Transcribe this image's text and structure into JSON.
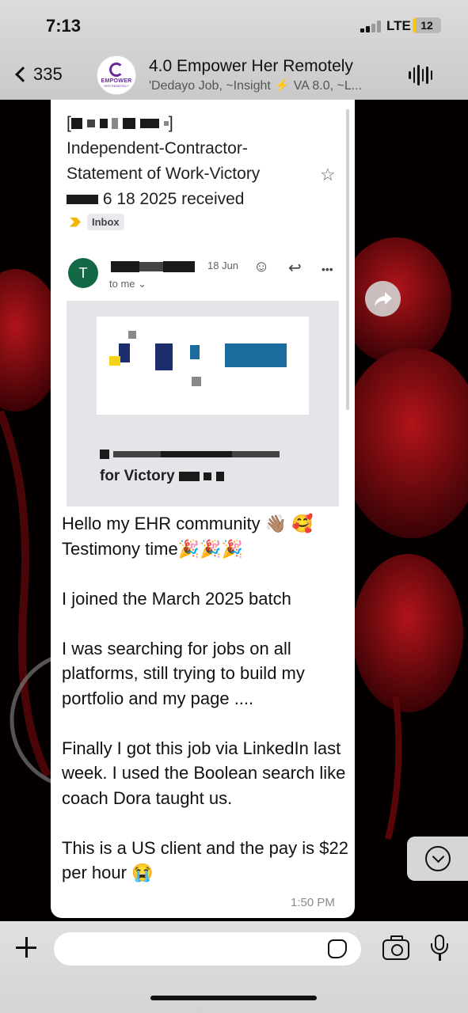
{
  "status_bar": {
    "time": "7:13",
    "network": "LTE",
    "battery": "12",
    "battery_level": 0.12
  },
  "header": {
    "back_count": "335",
    "avatar_brand": "EMPOWER",
    "avatar_sub": "HER REMOTELY",
    "title": "4.0 Empower Her Remotely",
    "members": "'Dedayo Job, ~Insight ⚡ VA 8.0, ~L..."
  },
  "email": {
    "subject_line1": "Independent-Contractor-",
    "subject_line2": "Statement of Work-Victory",
    "subject_line3_tail": "6 18 2025 received",
    "label": "Inbox",
    "sender_initial": "T",
    "date": "18 Jun",
    "to_me": "to me ⌄",
    "attachment_name": "for Victory"
  },
  "message": {
    "text": "Hello my EHR community 👋🏽 🥰\nTestimony time🎉🎉🎉\n\nI joined the March 2025 batch\n\nI was searching for jobs on all platforms, still trying to build my portfolio and my page ....\n\nFinally I got this job via LinkedIn last week. I used the Boolean search like coach Dora taught us.\n\nThis is a US client and the pay is $22 per hour 😭",
    "time": "1:50 PM"
  },
  "icons": {
    "back": "chevron-left-icon",
    "audio": "audio-wave-icon",
    "star": "☆",
    "emoji": "☺",
    "reply": "↩",
    "more": "•••",
    "forward": "forward-icon",
    "scroll_down": "chevron-down-circle-icon"
  },
  "colors": {
    "sender_avatar": "#136846",
    "label_arrow": "#f4b400",
    "battery_fill": "#f6c90e"
  }
}
